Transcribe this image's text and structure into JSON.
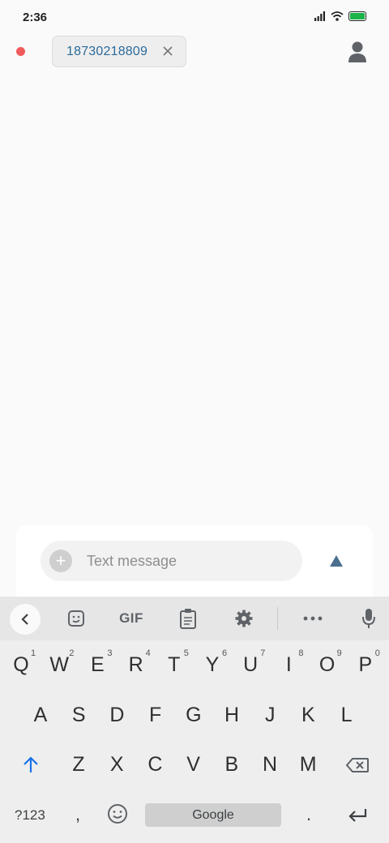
{
  "status_bar": {
    "time": "2:36",
    "colors": {
      "battery": "#1bb34a"
    }
  },
  "recipient": {
    "chip_text": "18730218809"
  },
  "compose": {
    "placeholder": "Text message"
  },
  "keyboard": {
    "toolbar": {
      "gif_label": "GIF"
    },
    "row1": [
      "Q",
      "W",
      "E",
      "R",
      "T",
      "Y",
      "U",
      "I",
      "O",
      "P"
    ],
    "row1_hints": [
      "1",
      "2",
      "3",
      "4",
      "5",
      "6",
      "7",
      "8",
      "9",
      "0"
    ],
    "row2": [
      "A",
      "S",
      "D",
      "F",
      "G",
      "H",
      "J",
      "K",
      "L"
    ],
    "row3": [
      "Z",
      "X",
      "C",
      "V",
      "B",
      "N",
      "M"
    ],
    "bottom": {
      "symbols_label": "?123",
      "comma": ",",
      "space_label": "Google",
      "period": "."
    }
  },
  "colors": {
    "accent": "#2b6a9a",
    "red_dot": "#ef5b5b",
    "send": "#4a6f8e",
    "shift": "#1a73e8"
  }
}
